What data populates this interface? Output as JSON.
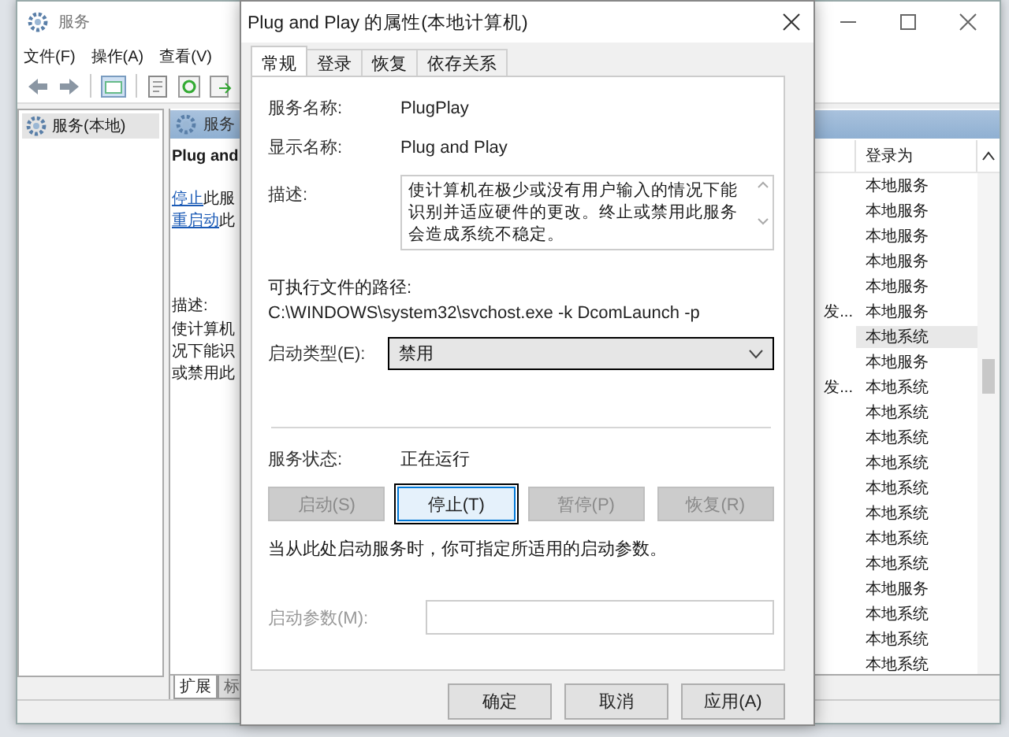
{
  "services_window": {
    "title": "服务",
    "menu": [
      "文件(F)",
      "操作(A)",
      "查看(V)"
    ],
    "tree": [
      {
        "label": "服务(本地)",
        "selected": true
      }
    ],
    "pane_header": "服务",
    "detail": {
      "service_title": "Plug and",
      "actions": [
        {
          "link": "停止",
          "text": "此服"
        },
        {
          "link": "重启动",
          "text": "此"
        }
      ],
      "description_label": "描述:",
      "description_lines": [
        "使计算机",
        "况下能识",
        "或禁用此"
      ]
    },
    "list": {
      "columns": [
        "登录为"
      ],
      "rows": [
        {
          "logon": "本地服务",
          "selected": false
        },
        {
          "logon": "本地服务",
          "selected": false
        },
        {
          "logon": "本地服务",
          "selected": false
        },
        {
          "logon": "本地服务",
          "selected": false
        },
        {
          "logon": "本地服务",
          "selected": false
        },
        {
          "column_1": "发...",
          "logon": "本地服务",
          "selected": false
        },
        {
          "logon": "本地系统",
          "selected": true
        },
        {
          "logon": "本地服务",
          "selected": false
        },
        {
          "column_1": "发...",
          "logon": "本地系统",
          "selected": false
        },
        {
          "logon": "本地系统",
          "selected": false
        },
        {
          "logon": "本地系统",
          "selected": false
        },
        {
          "logon": "本地系统",
          "selected": false
        },
        {
          "logon": "本地系统",
          "selected": false
        },
        {
          "logon": "本地系统",
          "selected": false
        },
        {
          "logon": "本地系统",
          "selected": false
        },
        {
          "logon": "本地系统",
          "selected": false
        },
        {
          "logon": "本地服务",
          "selected": false
        },
        {
          "logon": "本地系统",
          "selected": false
        },
        {
          "logon": "本地系统",
          "selected": false
        },
        {
          "logon": "本地系统",
          "selected": false
        }
      ]
    },
    "view_tabs": [
      {
        "label": "扩展",
        "selected": true
      },
      {
        "label": "标",
        "selected": false
      }
    ]
  },
  "dialog": {
    "title": "Plug and Play 的属性(本地计算机)",
    "tabs": [
      {
        "label": "常规",
        "selected": true
      },
      {
        "label": "登录",
        "selected": false
      },
      {
        "label": "恢复",
        "selected": false
      },
      {
        "label": "依存关系",
        "selected": false
      }
    ],
    "general": {
      "fields": [
        {
          "label": "服务名称:",
          "value": "PlugPlay"
        },
        {
          "label": "显示名称:",
          "value": "Plug and Play"
        }
      ],
      "description_label": "描述:",
      "description": "使计算机在极少或没有用户输入的情况下能识别并适应硬件的更改。终止或禁用此服务会造成系统不稳定。",
      "path_label": "可执行文件的路径:",
      "path": "C:\\WINDOWS\\system32\\svchost.exe -k DcomLaunch -p",
      "startup_type_label": "启动类型(E):",
      "startup_type": "禁用",
      "status_label": "服务状态:",
      "status": "正在运行",
      "control_buttons": [
        {
          "label": "启动(S)",
          "disabled": true,
          "focused": false
        },
        {
          "label": "停止(T)",
          "disabled": false,
          "focused": true
        },
        {
          "label": "暂停(P)",
          "disabled": true,
          "focused": false
        },
        {
          "label": "恢复(R)",
          "disabled": true,
          "focused": false
        }
      ],
      "hint": "当从此处启动服务时，你可指定所适用的启动参数。",
      "params_label": "启动参数(M):",
      "params_disabled": true
    },
    "buttons": [
      "确定",
      "取消",
      "应用(A)"
    ]
  }
}
